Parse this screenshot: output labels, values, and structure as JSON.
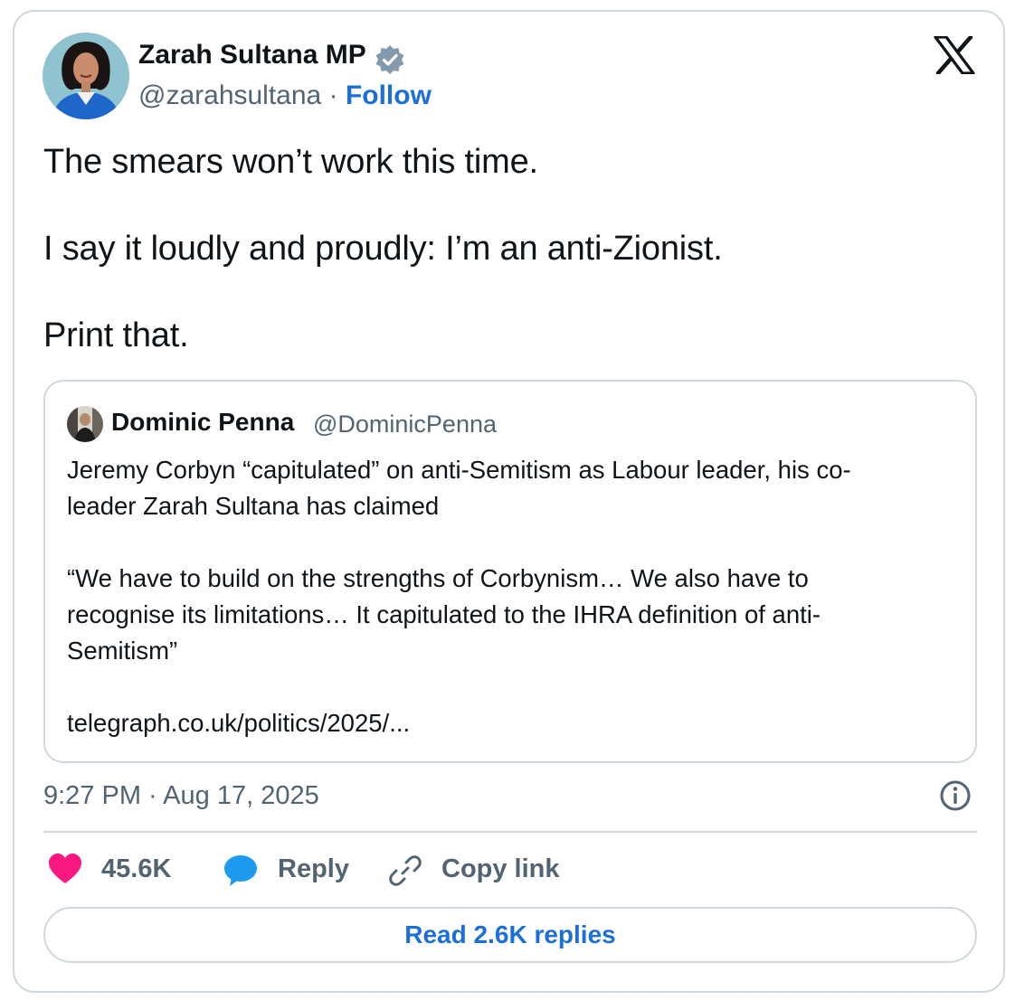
{
  "tweet": {
    "author": {
      "name": "Zarah Sultana MP",
      "handle": "@zarahsultana",
      "separator": "·",
      "follow_label": "Follow"
    },
    "lines": [
      "The smears won’t work this time.",
      "I say it loudly and proudly: I’m an anti-Zionist.",
      "Print that."
    ],
    "quote": {
      "name": "Dominic Penna",
      "handle": "@DominicPenna",
      "lines": [
        "Jeremy Corbyn “capitulated” on anti-Semitism as Labour leader, his co-",
        "leader Zarah Sultana has claimed",
        "“We have to build on the strengths of Corbynism… We also have to",
        "recognise its limitations… It capitulated to the IHRA definition of anti-",
        "Semitism”",
        "telegraph.co.uk/politics/2025/..."
      ]
    },
    "timestamp": "9:27 PM · Aug 17, 2025",
    "actions": {
      "like_count": "45.6K",
      "reply_label": "Reply",
      "copy_label": "Copy link"
    },
    "read_replies_label": "Read 2.6K replies"
  },
  "icons": {
    "verified": "verified-badge-icon",
    "logo": "x-logo-icon",
    "info": "info-icon",
    "like": "heart-icon",
    "reply": "speech-bubble-icon",
    "copy": "link-icon"
  },
  "colors": {
    "like": "#f91880",
    "reply": "#1d9bf0",
    "link": "#1d6fd8",
    "muted": "#536471",
    "border": "#cfd9de",
    "verified": "#829aab"
  }
}
